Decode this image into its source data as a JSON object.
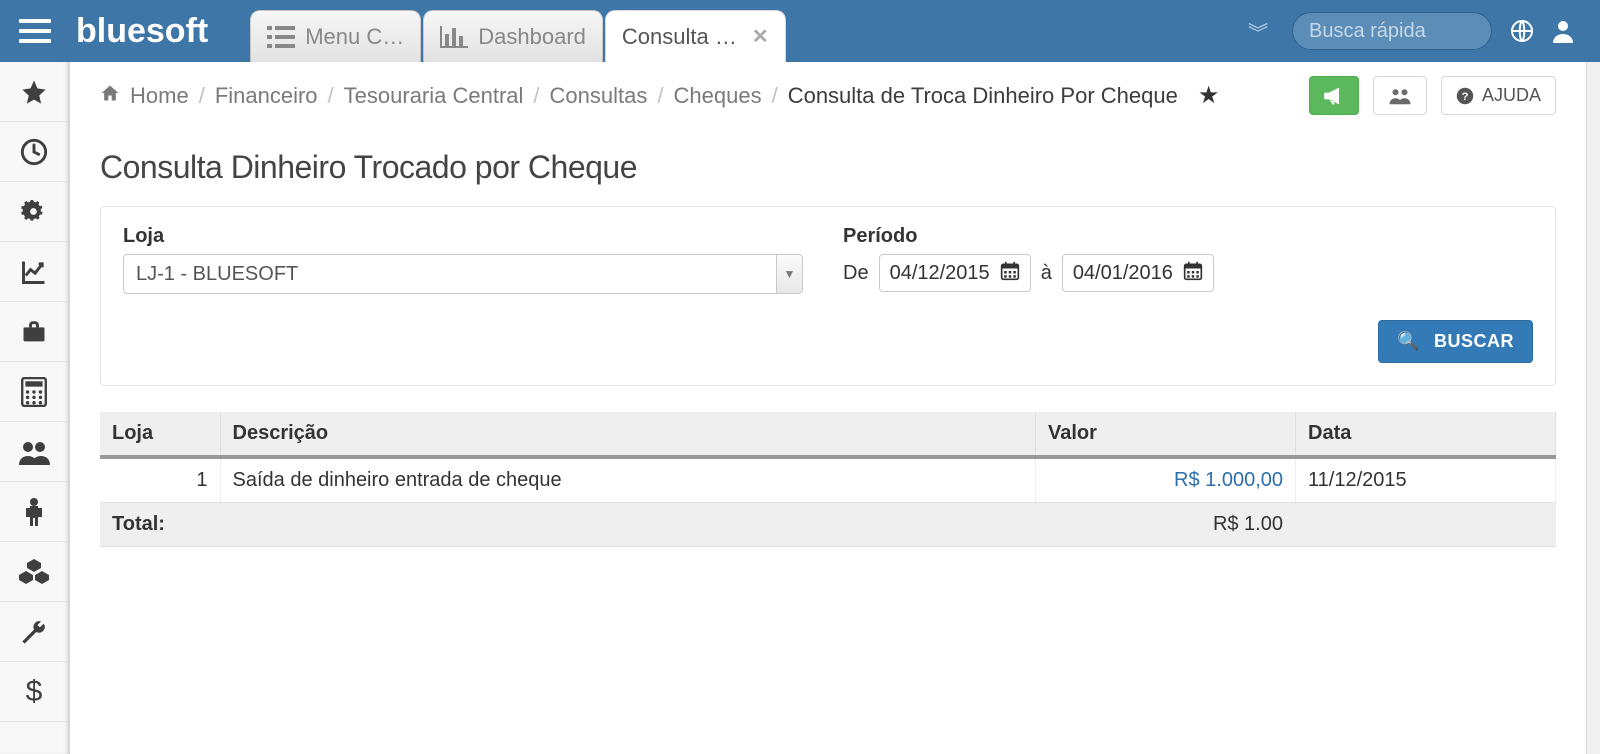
{
  "logo": "bluesoft",
  "tabs": [
    {
      "label": "Menu C…",
      "icon": "list"
    },
    {
      "label": "Dashboard",
      "icon": "chart"
    },
    {
      "label": "Consulta Di…",
      "icon": "",
      "active": true,
      "closable": true
    }
  ],
  "search": {
    "placeholder": "Busca rápida",
    "value": ""
  },
  "breadcrumb": {
    "home": "Home",
    "items": [
      "Financeiro",
      "Tesouraria Central",
      "Consultas",
      "Cheques"
    ],
    "current": "Consulta de Troca Dinheiro Por Cheque"
  },
  "help_label": "AJUDA",
  "page_title": "Consulta Dinheiro Trocado por Cheque",
  "filters": {
    "loja_label": "Loja",
    "loja_value": "LJ-1 - BLUESOFT",
    "periodo_label": "Período",
    "de_label": "De",
    "a_label": "à",
    "date_from": "04/12/2015",
    "date_to": "04/01/2016",
    "buscar_label": "BUSCAR"
  },
  "table": {
    "headers": {
      "loja": "Loja",
      "descricao": "Descrição",
      "valor": "Valor",
      "data": "Data"
    },
    "rows": [
      {
        "loja": "1",
        "descricao": "Saída de dinheiro entrada de cheque",
        "valor": "R$ 1.000,00",
        "data": "11/12/2015"
      }
    ],
    "total_label": "Total:",
    "total_value": "R$ 1.00"
  }
}
